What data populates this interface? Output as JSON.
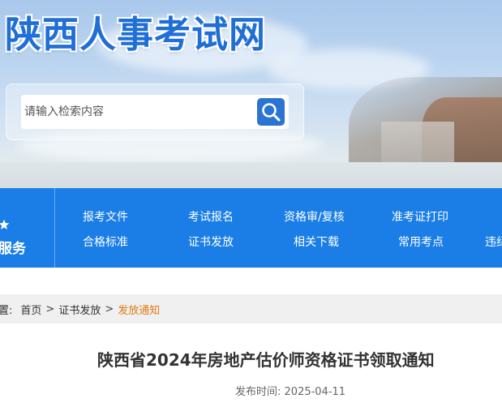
{
  "header": {
    "site_title": "陕西人事考试网",
    "search": {
      "placeholder": "请输入检索内容",
      "button_icon": "search-icon"
    }
  },
  "nav": {
    "side_label": "服务",
    "side_icon": "star-icon",
    "row1": [
      "报考文件",
      "考试报名",
      "资格审/复核",
      "准考证打印"
    ],
    "row2": [
      "合格标准",
      "证书发放",
      "相关下载",
      "常用考点",
      "违纪"
    ]
  },
  "breadcrumb": {
    "prefix": "置:",
    "items": [
      "首页",
      "证书发放",
      "发放通知"
    ],
    "separator": ">"
  },
  "article": {
    "title": "陕西省2024年房地产估价师资格证书领取通知",
    "publish_label": "发布时间:",
    "publish_date": "2025-04-11"
  },
  "colors": {
    "nav_bg": "#1a7ee6",
    "title_blue": "#1f6fd6",
    "breadcrumb_current": "#e07a10"
  }
}
